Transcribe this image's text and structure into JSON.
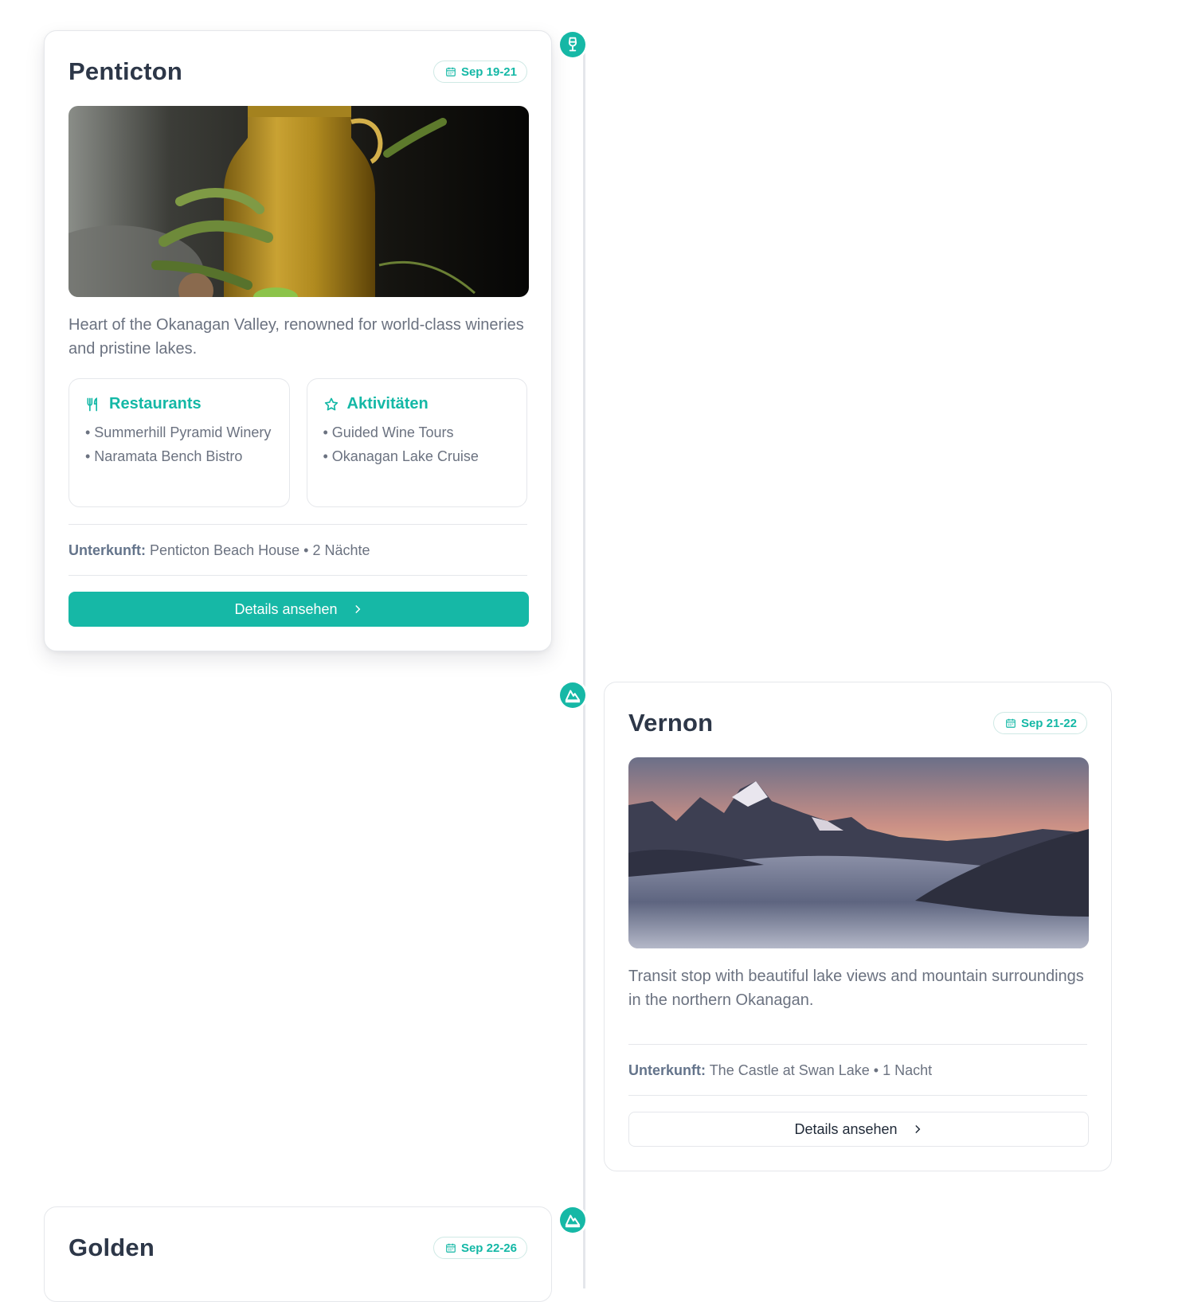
{
  "stops": [
    {
      "title": "Penticton",
      "date": "Sep 19-21",
      "marker_icon": "wine-glass-icon",
      "image": "olive-oil-bottle-photo",
      "description": "Heart of the Okanagan Valley, renowned for world-class wineries and pristine lakes.",
      "restaurants_label": "Restaurants",
      "restaurants": [
        "• Summerhill Pyramid Winery",
        "• Naramata Bench Bistro"
      ],
      "activities_label": "Aktivitäten",
      "activities": [
        "• Guided Wine Tours",
        "• Okanagan Lake Cruise"
      ],
      "stay_label": "Unterkunft:",
      "stay_value": "Penticton Beach House • 2 Nächte",
      "button_label": "Details ansehen"
    },
    {
      "title": "Vernon",
      "date": "Sep 21-22",
      "marker_icon": "mountain-icon",
      "image": "mountain-sunset-photo",
      "description": "Transit stop with beautiful lake views and mountain surroundings in the northern Okanagan.",
      "stay_label": "Unterkunft:",
      "stay_value": "The Castle at Swan Lake • 1 Nacht",
      "button_label": "Details ansehen"
    },
    {
      "title": "Golden",
      "date": "Sep 22-26",
      "marker_icon": "mountain-icon"
    }
  ],
  "colors": {
    "accent": "#16b8a6",
    "line": "#e5e7eb",
    "text_muted": "#6b7280",
    "title": "#2d3748"
  }
}
